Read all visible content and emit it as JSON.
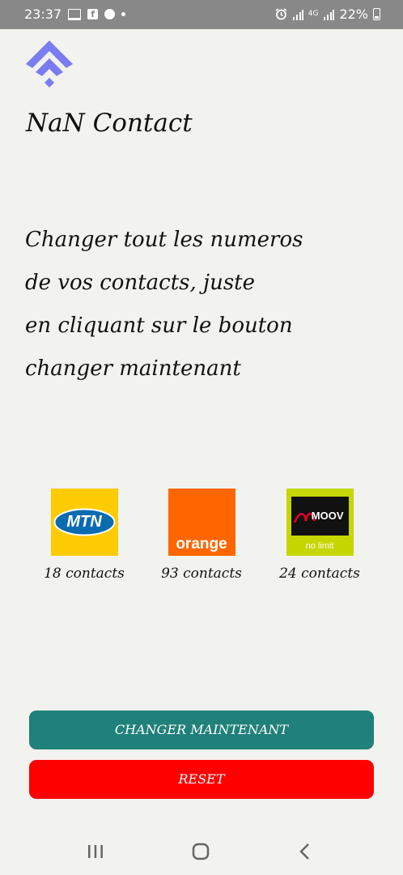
{
  "status_bar": {
    "time": "23:37",
    "network": "4G",
    "battery": "22%"
  },
  "app": {
    "title": "NaN Contact",
    "description_lines": [
      "Changer tout les numeros",
      "de vos contacts, juste",
      "en cliquant sur le bouton",
      "changer maintenant"
    ]
  },
  "operators": [
    {
      "name": "MTN",
      "logo_text": "MTN",
      "count_label": "18 contacts",
      "color": "#ffcb05"
    },
    {
      "name": "Orange",
      "logo_text": "orange",
      "count_label": "93 contacts",
      "color": "#ff6600"
    },
    {
      "name": "Moov",
      "logo_text": "moov",
      "tagline": "no limit",
      "count_label": "24 contacts",
      "color": "#c5d600"
    }
  ],
  "buttons": {
    "change_label": "CHANGER MAINTENANT",
    "reset_label": "RESET"
  },
  "colors": {
    "primary": "#20807a",
    "danger": "#fe0000",
    "logo_accent": "#7b7cf0",
    "background": "#f2f2ee"
  },
  "nav_icons": [
    "recents-icon",
    "home-icon",
    "back-icon"
  ]
}
